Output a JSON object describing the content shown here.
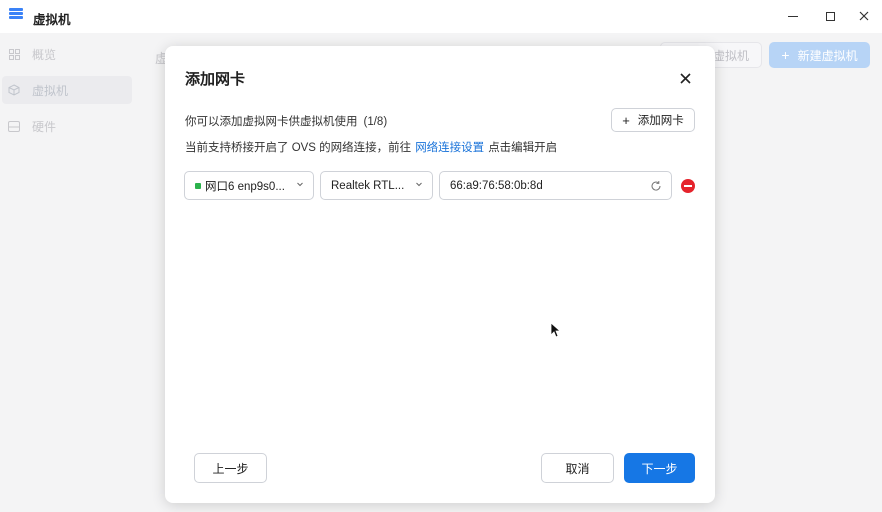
{
  "window": {
    "title": "虚拟机",
    "icon": "app-stack-icon"
  },
  "sidebar": {
    "items": [
      {
        "label": "概览",
        "icon": "grid-icon"
      },
      {
        "label": "虚拟机",
        "icon": "cube-icon"
      },
      {
        "label": "硬件",
        "icon": "drive-icon"
      }
    ]
  },
  "main": {
    "title": "虚",
    "secondary_button": "虚拟机",
    "new_vm_button": "新建虚拟机"
  },
  "dialog": {
    "title": "添加网卡",
    "close_icon": "close-icon",
    "description": "你可以添加虚拟网卡供虚拟机使用",
    "count": "(1/8)",
    "add_button": "添加网卡",
    "ovs_note_prefix": "当前支持桥接开启了 OVS 的网络连接，前往",
    "ovs_link": "网络连接设置",
    "ovs_note_suffix": "点击编辑开启",
    "nic": {
      "port": "网口6 enp9s0...",
      "port_status_color": "#2bb24c",
      "model": "Realtek RTL...",
      "mac": "66:a9:76:58:0b:8d"
    },
    "prev_button": "上一步",
    "cancel_button": "取消",
    "next_button": "下一步"
  },
  "colors": {
    "accent": "#1677e5",
    "danger": "#e5232b",
    "link": "#1a73d9"
  }
}
